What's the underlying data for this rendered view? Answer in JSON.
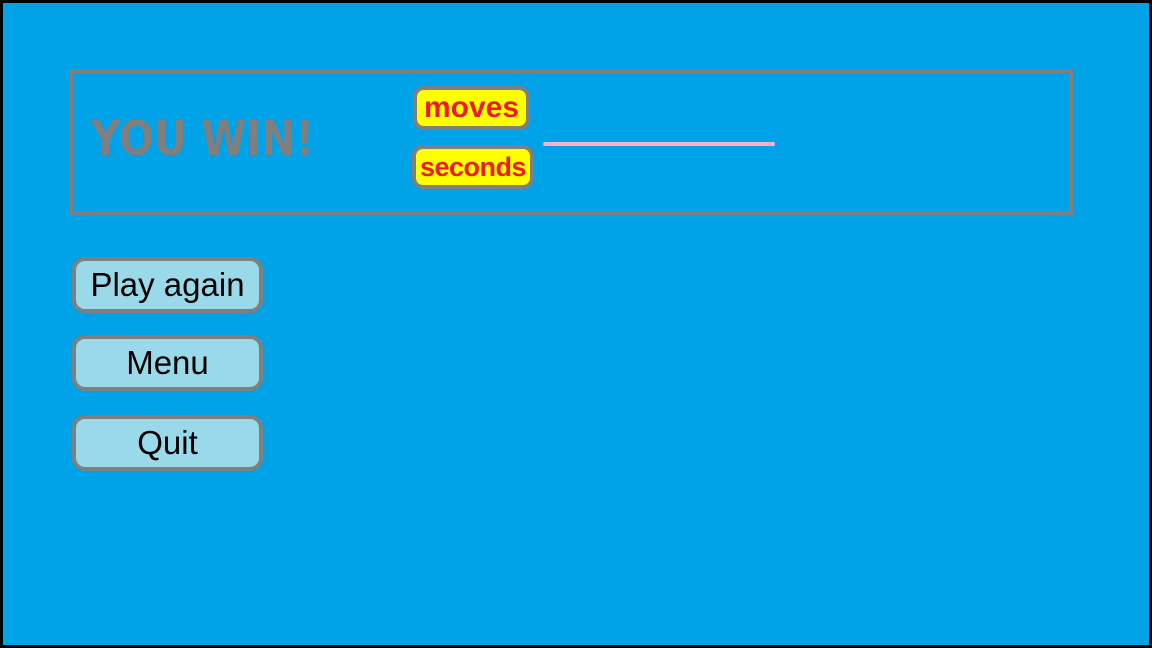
{
  "result_panel": {
    "title": "YOU WIN!",
    "moves_label": "moves",
    "seconds_label": "seconds"
  },
  "buttons": {
    "play_again": "Play again",
    "menu": "Menu",
    "quit": "Quit"
  },
  "colors": {
    "background": "#00a2e8",
    "panel_border": "#7f7f7f",
    "title_text": "#7f7f7f",
    "badge_fill": "#ffff00",
    "badge_text": "#ed1c24",
    "underline": "#ffaec9",
    "button_fill": "#99d9ea"
  }
}
